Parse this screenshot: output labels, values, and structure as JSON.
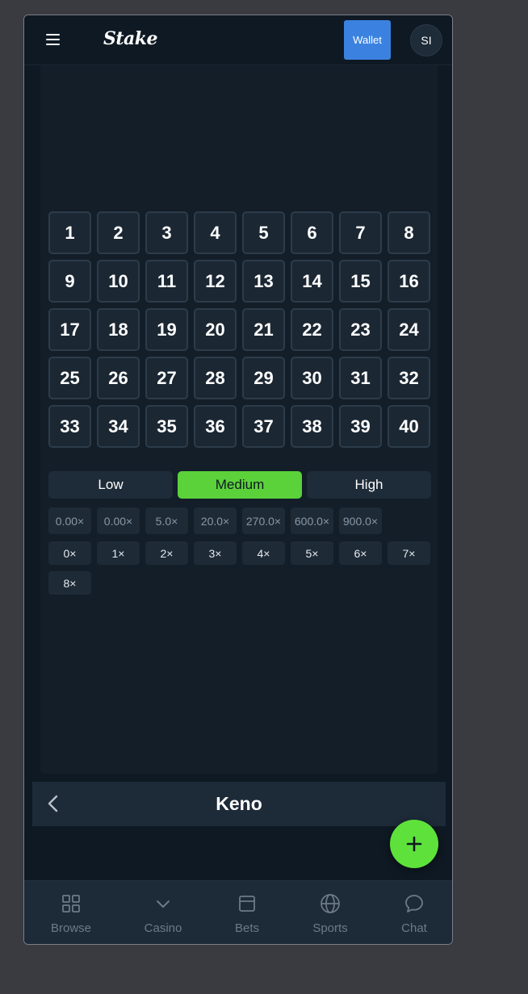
{
  "header": {
    "logo": "Stake",
    "wallet_label": "Wallet",
    "avatar_initials": "SI"
  },
  "keno": {
    "numbers": [
      "1",
      "2",
      "3",
      "4",
      "5",
      "6",
      "7",
      "8",
      "9",
      "10",
      "11",
      "12",
      "13",
      "14",
      "15",
      "16",
      "17",
      "18",
      "19",
      "20",
      "21",
      "22",
      "23",
      "24",
      "25",
      "26",
      "27",
      "28",
      "29",
      "30",
      "31",
      "32",
      "33",
      "34",
      "35",
      "36",
      "37",
      "38",
      "39",
      "40"
    ],
    "risk": {
      "options": [
        "Low",
        "Medium",
        "High"
      ],
      "selected": "Medium"
    },
    "multipliers": [
      "0.00×",
      "0.00×",
      "5.0×",
      "20.0×",
      "270.0×",
      "600.0×",
      "900.0×"
    ],
    "hits_row1": [
      "0×",
      "1×",
      "2×",
      "3×",
      "4×",
      "5×",
      "6×",
      "7×"
    ],
    "hits_row2": [
      "8×"
    ]
  },
  "game_bar": {
    "title": "Keno"
  },
  "bottom_nav": {
    "items": [
      {
        "label": "Browse",
        "icon": "grid-icon"
      },
      {
        "label": "Casino",
        "icon": "chevron-down-icon"
      },
      {
        "label": "Bets",
        "icon": "bets-icon"
      },
      {
        "label": "Sports",
        "icon": "globe-icon"
      },
      {
        "label": "Chat",
        "icon": "chat-icon"
      }
    ]
  },
  "colors": {
    "accent_green": "#5bd13a",
    "wallet_blue": "#3b82e0",
    "background": "#0f1923"
  }
}
